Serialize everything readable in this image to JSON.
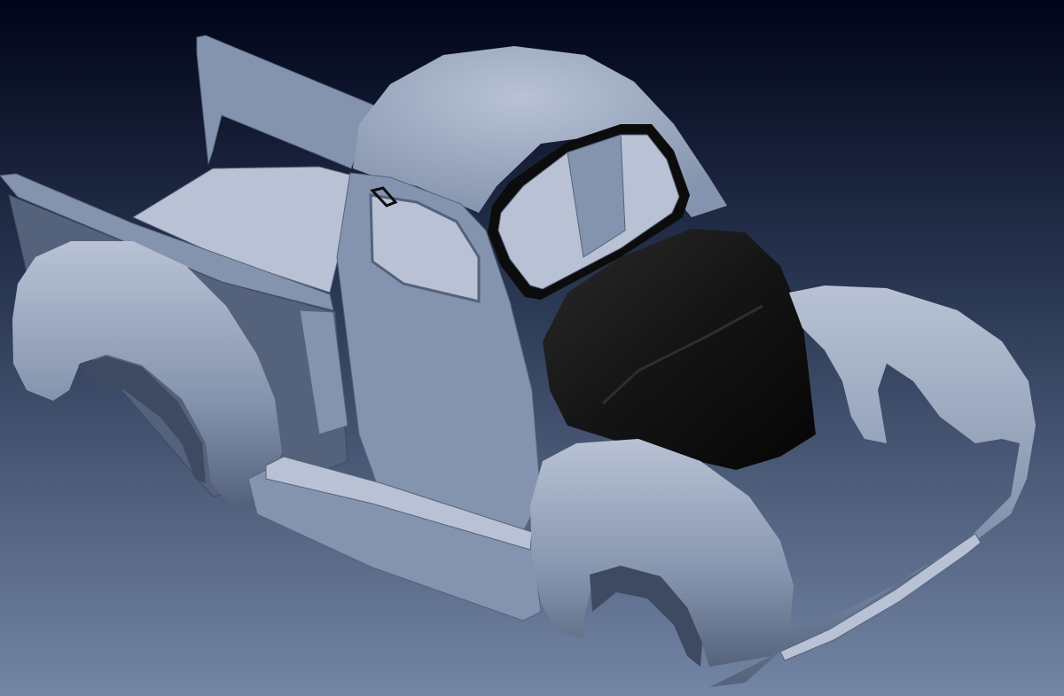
{
  "viewport": {
    "background_top": "#000418",
    "background_mid": "#2d3b57",
    "background_bottom": "#7486a5"
  },
  "model": {
    "body_color": "#8594ae",
    "body_highlight": "#b8c2d4",
    "body_shadow": "#55627c",
    "body_dark": "#3e4a62",
    "hood_color": "#141414",
    "window_trim": "#0c0c0c"
  }
}
